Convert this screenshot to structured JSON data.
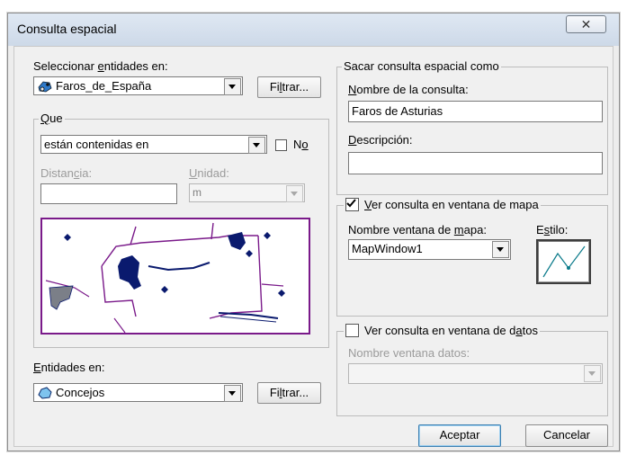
{
  "window": {
    "title": "Consulta espacial",
    "close_glyph": "☒"
  },
  "select_entities": {
    "label": "Seleccionar entidades en:",
    "value": "Faros_de_España",
    "filter_button": "Filtrar...",
    "icon": "points-layer-icon"
  },
  "que": {
    "group_title": "Que",
    "relation": "están contenidas en",
    "no_label": "No",
    "no_checked": false,
    "distance_label": "Distancia:",
    "distance_value": "",
    "unit_label": "Unidad:",
    "unit_value": "m"
  },
  "entities_in": {
    "label": "Entidades en:",
    "value": "Concejos",
    "filter_button": "Filtrar...",
    "icon": "polygon-layer-icon"
  },
  "output": {
    "group_title": "Sacar consulta espacial como",
    "name_label": "Nombre de la consulta:",
    "name_value": "Faros de Asturias",
    "desc_label": "Descripción:",
    "desc_value": ""
  },
  "map_window": {
    "checkbox_label": "Ver consulta en ventana de mapa",
    "checked": true,
    "window_name_label": "Nombre ventana de mapa:",
    "window_name_value": "MapWindow1",
    "style_label": "Estilo:",
    "style_icon": "line-style-icon"
  },
  "data_window": {
    "checkbox_label": "Ver consulta en ventana de datos",
    "checked": false,
    "window_name_label": "Nombre ventana datos:",
    "window_name_value": ""
  },
  "buttons": {
    "ok": "Aceptar",
    "cancel": "Cancelar"
  },
  "colors": {
    "dark_blue": "#0a1a6e",
    "purple": "#7a1a8a",
    "gray_shape": "#7b7f88"
  }
}
